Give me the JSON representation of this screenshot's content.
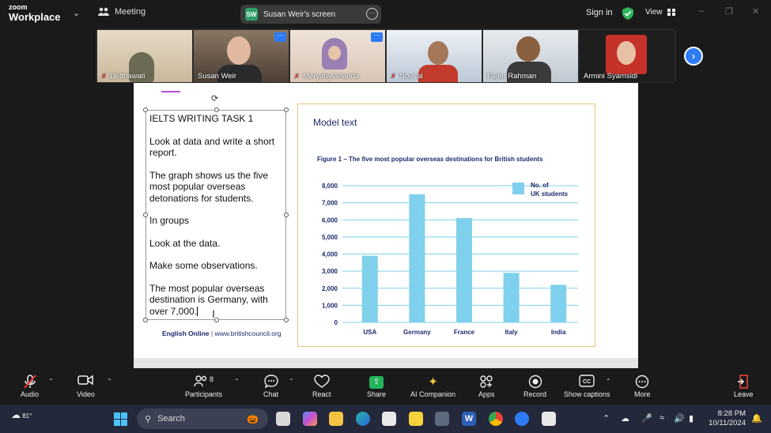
{
  "topbar": {
    "brand_top": "zoom",
    "brand_bottom": "Workplace",
    "meeting_label": "Meeting",
    "screen_initials": "SW",
    "screen_title": "Susan Weir's screen",
    "sign_in": "Sign in",
    "view_label": "View"
  },
  "participants": [
    {
      "name": "Delthawati",
      "muted": true,
      "bg": "#d9c9b0"
    },
    {
      "name": "Susan Weir",
      "muted": false,
      "bg": "#6d5b4b"
    },
    {
      "name": "Meryany Ananda",
      "muted": true,
      "bg": "#e4d6c9"
    },
    {
      "name": "Nouval",
      "muted": true,
      "bg": "#c9d4e0"
    },
    {
      "name": "Fajlur Rahman",
      "muted": false,
      "bg": "#cfd7df"
    },
    {
      "name": "Armini Syamsidi",
      "muted": false,
      "bg": "#1e1e1e"
    }
  ],
  "slide": {
    "paragraphs": [
      "IELTS WRITING TASK 1",
      "Look at data and write a short report.",
      "The graph shows us the five most popular overseas detonations for students.",
      "In groups",
      "Look at the data.",
      "Make some observations.",
      "The most popular overseas destination is Germany, with over 7,000."
    ],
    "footer_brand": "English Online",
    "footer_sep": " | ",
    "footer_url": "www.britishcouncil.org",
    "model_text": "Model text",
    "figure_title": "Figure 1 – The five most popular overseas destinations for British students"
  },
  "chart_data": {
    "type": "bar",
    "title": "Figure 1 – The five most popular overseas destinations for British students",
    "categories": [
      "USA",
      "Germany",
      "France",
      "Italy",
      "India"
    ],
    "series": [
      {
        "name": "No. of UK students",
        "values": [
          3900,
          7500,
          6100,
          2900,
          2200
        ]
      }
    ],
    "yticks": [
      "0",
      "1,000",
      "2,000",
      "3,000",
      "4,000",
      "5,000",
      "6,000",
      "7,000",
      "8,000"
    ],
    "ylim": [
      0,
      8000
    ],
    "grid": true,
    "legend_position": "top-right",
    "legend_line1": "No. of",
    "legend_line2": "UK students",
    "bar_color": "#7fd0ec"
  },
  "toolbar": {
    "audio": "Audio",
    "video": "Video",
    "participants": "Participants",
    "participants_count": "8",
    "chat": "Chat",
    "react": "React",
    "share": "Share",
    "ai": "AI Companion",
    "apps": "Apps",
    "record": "Record",
    "captions": "Show captions",
    "more": "More",
    "leave": "Leave"
  },
  "taskbar": {
    "temperature": "81°",
    "search_placeholder": "Search",
    "time": "8:28 PM",
    "date": "10/11/2024"
  }
}
